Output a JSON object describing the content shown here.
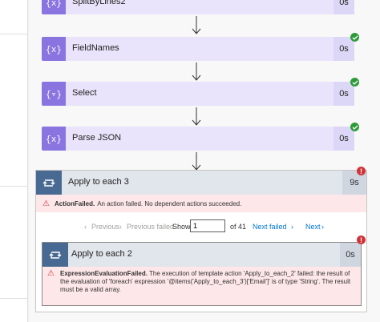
{
  "actions": [
    {
      "label": "SplitByLines2",
      "duration": "0s",
      "icon": "expression-icon"
    },
    {
      "label": "FieldNames",
      "duration": "0s",
      "icon": "expression-icon"
    },
    {
      "label": "Select",
      "duration": "0s",
      "icon": "filter-icon"
    },
    {
      "label": "Parse JSON",
      "duration": "0s",
      "icon": "expression-icon"
    }
  ],
  "apply_to_each_3": {
    "label": "Apply to each 3",
    "duration": "9s",
    "error_title": "ActionFailed.",
    "error_message": "An action failed. No dependent actions succeeded."
  },
  "pager": {
    "previous": "Previous",
    "previous_failed": "Previous failed",
    "show_label": "Show",
    "page_value": "1",
    "total": "of 41",
    "next_failed": "Next failed",
    "next": "Next"
  },
  "apply_to_each_2": {
    "label": "Apply to each 2",
    "duration": "0s",
    "error_title": "ExpressionEvaluationFailed.",
    "error_message": "The execution of template action 'Apply_to_each_2' failed: the result of the evaluation of 'foreach' expression '@items('Apply_to_each_3')['Email']' is of type 'String'. The result must be a valid array."
  },
  "colors": {
    "action_bg": "#e9e4fb",
    "action_icon": "#8a74e0",
    "success": "#2e9b3a",
    "error": "#d13438",
    "loop_icon": "#486991",
    "link": "#0078d4"
  }
}
